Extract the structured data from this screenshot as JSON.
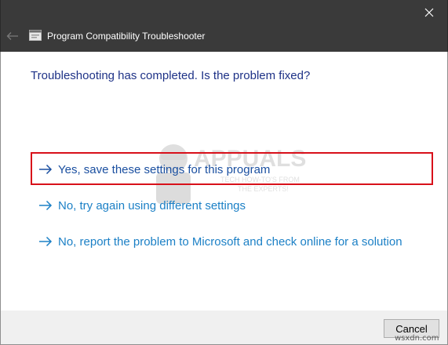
{
  "window": {
    "title": "Program Compatibility Troubleshooter",
    "back_icon": "back-arrow-icon",
    "close_icon": "close-icon",
    "app_icon": "troubleshooter-app-icon"
  },
  "main": {
    "question": "Troubleshooting has completed.  Is the problem fixed?",
    "options": [
      {
        "label": "Yes, save these settings for this program",
        "icon": "right-arrow-icon",
        "highlighted": true
      },
      {
        "label": "No, try again using different settings",
        "icon": "right-arrow-icon",
        "highlighted": false
      },
      {
        "label": "No, report the problem to Microsoft and check online for a solution",
        "icon": "right-arrow-icon",
        "highlighted": false
      }
    ]
  },
  "footer": {
    "cancel_label": "Cancel"
  },
  "watermark": {
    "brand": "APPUALS",
    "tagline_1": "TECH HOW-TO'S FROM",
    "tagline_2": "THE EXPERTS!"
  },
  "site_mark": "wsxdn.com",
  "colors": {
    "titlebar": "#3a3a3a",
    "question_text": "#1e3287",
    "link_text": "#1c80c6",
    "highlight_border": "#d8101a",
    "footer_bg": "#f0f0f0"
  }
}
